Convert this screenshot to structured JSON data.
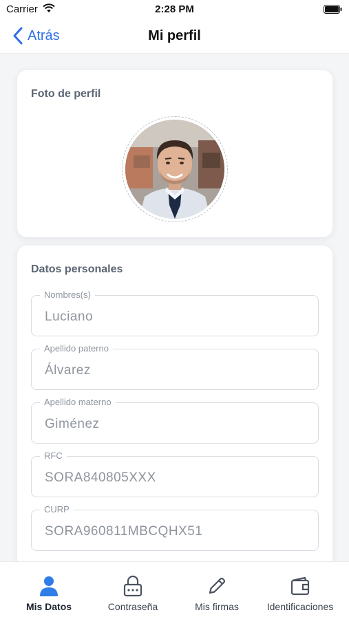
{
  "status_bar": {
    "carrier": "Carrier",
    "time": "2:28 PM",
    "icons": [
      "wifi-icon",
      "battery-icon"
    ]
  },
  "nav": {
    "back_label": "Atrás",
    "title": "Mi perfil",
    "back_icon": "chevron-left-icon"
  },
  "photo_card": {
    "title": "Foto de perfil",
    "avatar": "profile-photo"
  },
  "personal_card": {
    "title": "Datos personales",
    "fields": [
      {
        "label": "Nombres(s)",
        "value": "Luciano"
      },
      {
        "label": "Apellido paterno",
        "value": "Álvarez"
      },
      {
        "label": "Apellido materno",
        "value": "Giménez"
      },
      {
        "label": "RFC",
        "value": "SORA840805XXX"
      },
      {
        "label": "CURP",
        "value": "SORA960811MBCQHX51"
      }
    ]
  },
  "tab_bar": {
    "tabs": [
      {
        "label": "Mis Datos",
        "icon": "person-icon",
        "active": true
      },
      {
        "label": "Contraseña",
        "icon": "lock-icon",
        "active": false
      },
      {
        "label": "Mis firmas",
        "icon": "pencil-icon",
        "active": false
      },
      {
        "label": "Identificaciones",
        "icon": "wallet-icon",
        "active": false
      }
    ]
  },
  "colors": {
    "accent": "#2f6ee5",
    "active_tab_icon": "#2f7de8",
    "inactive_tab_icon": "#4a5260",
    "background": "#f4f5f7"
  }
}
